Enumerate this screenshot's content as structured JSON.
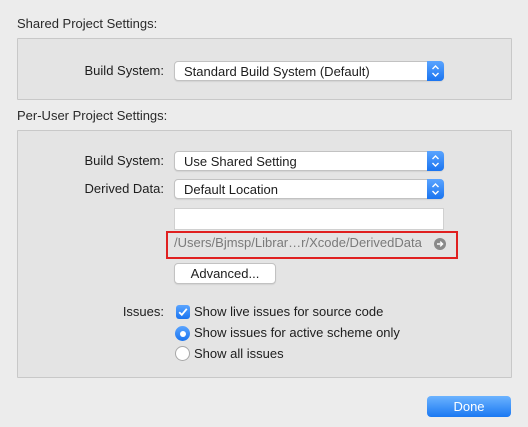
{
  "shared": {
    "title": "Shared Project Settings:",
    "build_system_label": "Build System:",
    "build_system_value": "Standard Build System (Default)"
  },
  "per_user": {
    "title": "Per-User Project Settings:",
    "build_system_label": "Build System:",
    "build_system_value": "Use Shared Setting",
    "derived_data_label": "Derived Data:",
    "derived_data_value": "Default Location",
    "custom_path_value": "",
    "derived_data_path": "/Users/Bjmsp/Librar…r/Xcode/DerivedData",
    "advanced_label": "Advanced...",
    "issues_label": "Issues:",
    "issue_options": {
      "live_issues": "Show live issues for source code",
      "active_scheme": "Show issues for active scheme only",
      "all_issues": "Show all issues"
    },
    "live_issues_checked": true,
    "selected_issue_scope": "active_scheme"
  },
  "footer": {
    "done_label": "Done"
  },
  "colors": {
    "accent": "#1a78f2",
    "highlight": "#e02020"
  }
}
